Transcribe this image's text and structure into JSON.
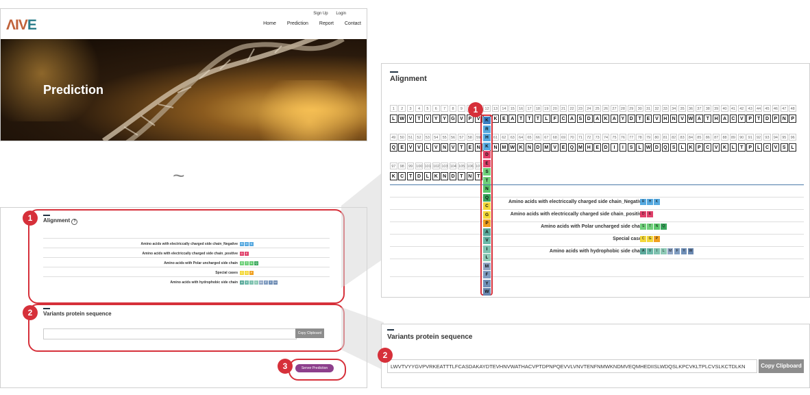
{
  "site": {
    "logo": [
      "ΛIV",
      "E"
    ],
    "top_links": [
      "Sign Up",
      "Login"
    ],
    "nav": [
      "Home",
      "Prediction",
      "Report",
      "Contact"
    ],
    "hero_title": "Prediction",
    "tilde": "~"
  },
  "overview": {
    "badges": [
      "1",
      "2",
      "3"
    ],
    "alignment_title": "Alignment",
    "help_icon": "?",
    "legend": [
      "Amino acids with electriccally charged side chain_Negative",
      "Amino acids with electriccally charged side chain_positive",
      "Amino acids with Polar uncharged side chain",
      "Special cases",
      "Amino acids with hydrophobic side chain"
    ],
    "variants_title": "Variants protein sequence",
    "copy_label": "Copy Clipboard",
    "server_button": "Server Prediction"
  },
  "alignment": {
    "title": "Alignment",
    "badge": "1",
    "rows": [
      {
        "numbers": [
          "1",
          "2",
          "3",
          "4",
          "5",
          "6",
          "7",
          "8",
          "9",
          "10",
          "11",
          "12",
          "13",
          "14",
          "15",
          "16",
          "17",
          "18",
          "19",
          "20",
          "21",
          "22",
          "23",
          "24",
          "25",
          "26",
          "27",
          "28",
          "29",
          "30",
          "31",
          "32",
          "33",
          "34",
          "35",
          "36",
          "37",
          "38",
          "39",
          "40",
          "41",
          "42",
          "43",
          "44",
          "45",
          "46",
          "47",
          "48"
        ],
        "seq": [
          "L",
          "W",
          "V",
          "T",
          "V",
          "Y",
          "Y",
          "G",
          "V",
          "P",
          "V",
          "K",
          "K",
          "E",
          "A",
          "T",
          "T",
          "T",
          "L",
          "F",
          "C",
          "A",
          "S",
          "D",
          "A",
          "K",
          "A",
          "Y",
          "D",
          "T",
          "E",
          "V",
          "H",
          "N",
          "V",
          "W",
          "A",
          "T",
          "H",
          "A",
          "C",
          "V",
          "P",
          "T",
          "D",
          "P",
          "N",
          "P"
        ]
      },
      {
        "numbers": [
          "49",
          "50",
          "51",
          "52",
          "53",
          "54",
          "55",
          "56",
          "57",
          "58",
          "59",
          "60",
          "61",
          "62",
          "63",
          "64",
          "65",
          "66",
          "67",
          "68",
          "69",
          "70",
          "71",
          "72",
          "73",
          "74",
          "75",
          "76",
          "77",
          "78",
          "79",
          "80",
          "81",
          "82",
          "83",
          "84",
          "85",
          "86",
          "87",
          "88",
          "89",
          "90",
          "91",
          "92",
          "93",
          "94",
          "95",
          "96"
        ],
        "seq": [
          "Q",
          "E",
          "V",
          "V",
          "L",
          "V",
          "N",
          "V",
          "T",
          "E",
          "N",
          "F",
          "N",
          "M",
          "W",
          "K",
          "N",
          "D",
          "M",
          "V",
          "E",
          "Q",
          "M",
          "H",
          "E",
          "D",
          "I",
          "I",
          "S",
          "L",
          "W",
          "D",
          "Q",
          "S",
          "L",
          "K",
          "P",
          "C",
          "V",
          "K",
          "L",
          "T",
          "P",
          "L",
          "C",
          "V",
          "S",
          "L"
        ]
      },
      {
        "numbers": [
          "97",
          "98",
          "99",
          "100",
          "101",
          "102",
          "103",
          "104",
          "105",
          "106",
          "107"
        ],
        "seq": [
          "K",
          "C",
          "T",
          "D",
          "L",
          "K",
          "N",
          "D",
          "T",
          "N",
          "T"
        ]
      }
    ],
    "variant_column": [
      "K",
      "R",
      "H",
      "K",
      "D",
      "E",
      "S",
      "T",
      "N",
      "Q",
      "C",
      "G",
      "P",
      "A",
      "V",
      "I",
      "L",
      "M",
      "F",
      "Y",
      "W"
    ],
    "variant_colors": [
      "#3a7ec2",
      "#56a9e0",
      "#56a9e0",
      "#56a9e0",
      "#e0406a",
      "#e0406a",
      "#6fd07a",
      "#6fd07a",
      "#5cc86c",
      "#3aa65c",
      "#f4d83a",
      "#f4d83a",
      "#f0a020",
      "#5aa89a",
      "#6ab8a8",
      "#7ec2b0",
      "#8ecab6",
      "#8fa4c4",
      "#7f9cc0",
      "#7090b8",
      "#6a88b0"
    ],
    "legend": [
      {
        "label": "Amino acids with electriccally charged side chain_Negative",
        "chips": [
          "R",
          "H",
          "K"
        ],
        "colors": [
          "#56a9e0",
          "#56a9e0",
          "#56a9e0"
        ]
      },
      {
        "label": "Amino acids with electriccally charged side chain_positive",
        "chips": [
          "D",
          "E"
        ],
        "colors": [
          "#e0406a",
          "#e0406a"
        ]
      },
      {
        "label": "Amino acids with Polar uncharged side chain",
        "chips": [
          "S",
          "T",
          "N",
          "Q"
        ],
        "colors": [
          "#6fd07a",
          "#6fd07a",
          "#5cc86c",
          "#3aa65c"
        ]
      },
      {
        "label": "Special cases",
        "chips": [
          "C",
          "G",
          "P"
        ],
        "colors": [
          "#f4d83a",
          "#f4d83a",
          "#f0a020"
        ]
      },
      {
        "label": "Amino acids with hydrophobic side chain",
        "chips": [
          "A",
          "V",
          "I",
          "L",
          "M",
          "F",
          "Y",
          "W"
        ],
        "colors": [
          "#5aa89a",
          "#6ab8a8",
          "#7ec2b0",
          "#8ecab6",
          "#8fa4c4",
          "#7f9cc0",
          "#7090b8",
          "#6a88b0"
        ]
      }
    ]
  },
  "variants": {
    "title": "Variants protein sequence",
    "badge": "2",
    "sequence": "LWVTVYYGVPVRKEATTTLFCASDAKAYDTEVHNVWATHACVPTDPNPQEVVLVNVTENFNMWKNDMVEQMHEDIISLWDQSLKPCVKLTPLCVSLKCTDLKN",
    "copy_label": "Copy Clipboard"
  }
}
